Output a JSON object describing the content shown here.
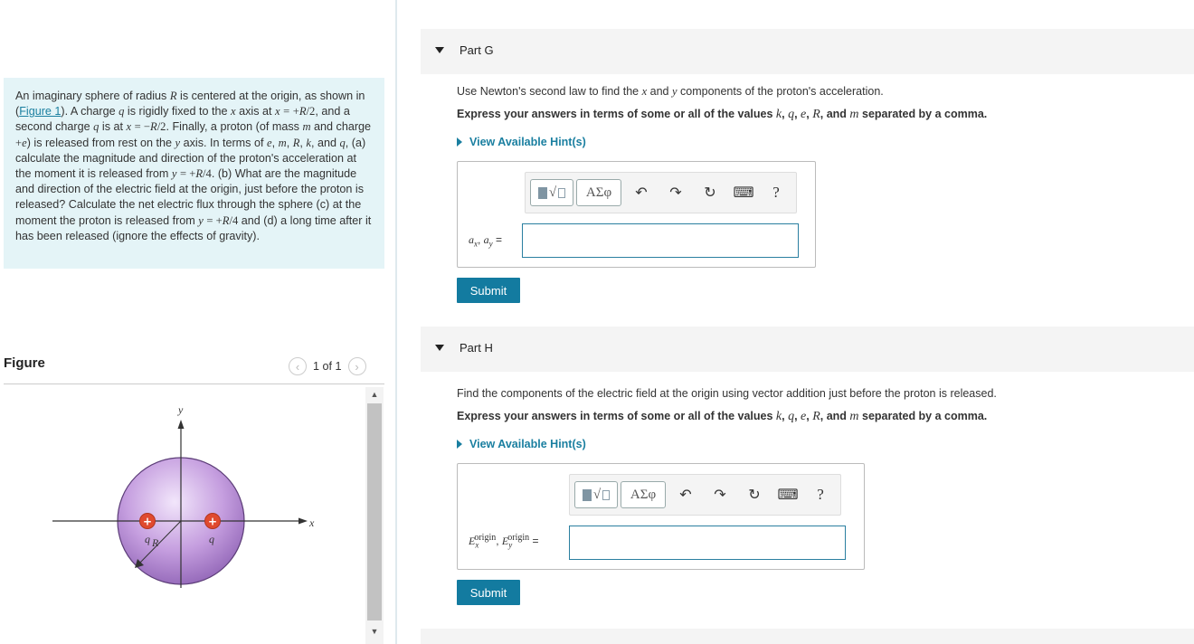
{
  "problem": {
    "figure_link": "Figure 1"
  },
  "figure": {
    "title": "Figure",
    "pager_text": "1 of 1",
    "prev_icon": "chevron-left-icon",
    "next_icon": "chevron-right-icon",
    "labels": {
      "y_axis": "y",
      "x_axis": "x",
      "charge_left": "q",
      "charge_right": "q",
      "radius": "R"
    },
    "colors": {
      "sphere": "#b48ed0",
      "charge": "#e04a2f"
    }
  },
  "part_g": {
    "title": "Part G",
    "instruction": "Use Newton's second law to find the",
    "hint_label": "View Available Hint(s)",
    "answer_value": "",
    "submit_label": "Submit"
  },
  "part_h": {
    "title": "Part H",
    "instruction": "Find the components of the electric field at the origin using vector addition just before the proton is released.",
    "hint_label": "View Available Hint(s)",
    "answer_value": "",
    "submit_label": "Submit"
  },
  "toolbar": {
    "greek_label": "ΑΣφ",
    "help_label": "?",
    "icons": [
      "templates-icon",
      "greek-icon",
      "undo-icon",
      "redo-icon",
      "reset-icon",
      "keyboard-icon",
      "help-icon"
    ]
  },
  "colors": {
    "accent": "#137ba0",
    "problem_bg": "#e4f4f7",
    "link": "#1a7fa0"
  }
}
